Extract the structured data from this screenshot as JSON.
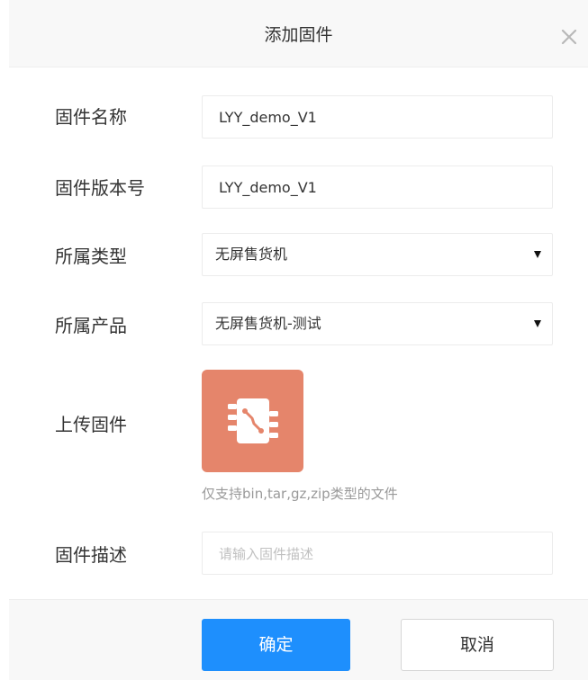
{
  "dialog": {
    "title": "添加固件"
  },
  "form": {
    "name": {
      "label": "固件名称",
      "value": "LYY_demo_V1"
    },
    "version": {
      "label": "固件版本号",
      "value": "LYY_demo_V1"
    },
    "type": {
      "label": "所属类型",
      "selected": "无屏售货机"
    },
    "product": {
      "label": "所属产品",
      "selected": "无屏售货机-测试"
    },
    "upload": {
      "label": "上传固件",
      "hint": "仅支持bin,tar,gz,zip类型的文件",
      "icon": "firmware-chip-icon",
      "tile_color": "#e5856b"
    },
    "description": {
      "label": "固件描述",
      "placeholder": "请输入固件描述",
      "value": ""
    }
  },
  "footer": {
    "confirm_label": "确定",
    "cancel_label": "取消"
  },
  "colors": {
    "primary": "#1e8ffd",
    "upload_tile": "#e5856b"
  }
}
